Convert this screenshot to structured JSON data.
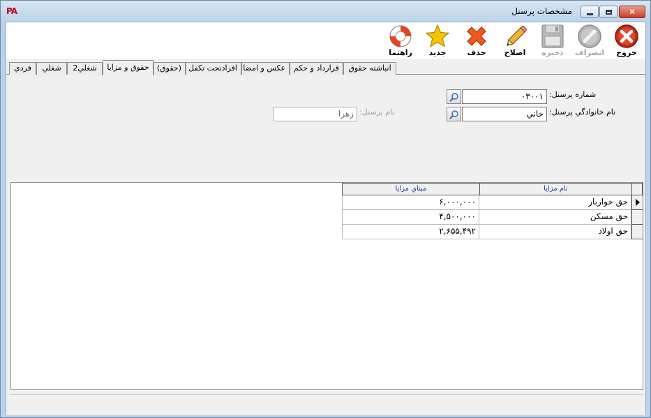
{
  "window": {
    "app_logo": "PA",
    "title": "مشخصات پرسنل"
  },
  "toolbar": {
    "exit_label": "خروج",
    "cancel_label": "انصراف",
    "save_label": "ذخيره",
    "edit_label": "اصلاح",
    "delete_label": "حذف",
    "new_label": "جديد",
    "help_label": "راهنما"
  },
  "tabs": [
    {
      "label": "فردي"
    },
    {
      "label": "شغلي"
    },
    {
      "label": "شغلي2"
    },
    {
      "label": "حقوق و مزايا"
    },
    {
      "label": "(حقوق)"
    },
    {
      "label": "افرادتحت تكفل"
    },
    {
      "label": "عكس و امضا"
    },
    {
      "label": "قرارداد و حكم"
    },
    {
      "label": "انباشته حقوق"
    }
  ],
  "form": {
    "personnel_no_label": "شماره پرسنل:",
    "personnel_no_value": "۰۳۰۰۱",
    "last_name_label": "نام خانوادگي پرسنل:",
    "last_name_value": "خاني",
    "first_name_label": "نام پرسنل:",
    "first_name_value": "زهرا"
  },
  "grid": {
    "columns": [
      "نام مزايا",
      "مبناي مزايا"
    ],
    "rows": [
      {
        "name": "حق خواربار",
        "value": "۶,۰۰۰,۰۰۰"
      },
      {
        "name": "حق مسكن",
        "value": "۴,۵۰۰,۰۰۰"
      },
      {
        "name": "حق اولاد",
        "value": "۲,۶۵۵,۴۹۲"
      }
    ]
  },
  "colors": {
    "title_bar": "#bcd3ea",
    "panel_bg": "#f0f0f0",
    "exit_red": "#c62a1a",
    "delete_orange": "#ef5a1a",
    "star_yellow": "#f5c400",
    "header_text": "#1a3a8c"
  }
}
